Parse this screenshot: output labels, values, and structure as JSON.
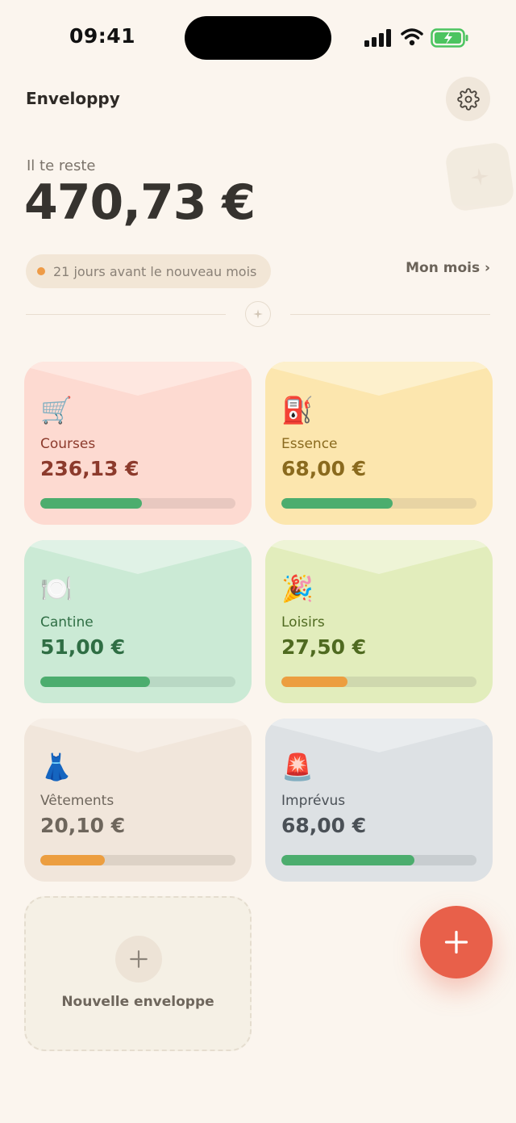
{
  "status_bar": {
    "time": "09:41"
  },
  "header": {
    "title": "Enveloppy"
  },
  "balance": {
    "label": "Il te reste",
    "amount": "470,73 €",
    "days_left": "21 jours avant le nouveau mois",
    "month_link": "Mon mois ›"
  },
  "envelopes": [
    {
      "emoji": "🛒",
      "name": "Courses",
      "amount": "236,13 €",
      "progress": 0.52,
      "colors": {
        "bg": "#FDDAD1",
        "flap": "#FEE7E0",
        "text": "#8C3A2C",
        "track": "#E8C8C0",
        "fill": "#4CAD6E"
      }
    },
    {
      "emoji": "⛽",
      "name": "Essence",
      "amount": "68,00 €",
      "progress": 0.57,
      "colors": {
        "bg": "#FCE6AE",
        "flap": "#FDF0CC",
        "text": "#8A6A1E",
        "track": "#E8D4A4",
        "fill": "#4CAD6E"
      }
    },
    {
      "emoji": "🍽️",
      "name": "Cantine",
      "amount": "51,00 €",
      "progress": 0.56,
      "colors": {
        "bg": "#CBEAD5",
        "flap": "#E0F2E6",
        "text": "#2F6E44",
        "track": "#B9D8C4",
        "fill": "#4CAD6E"
      }
    },
    {
      "emoji": "🎉",
      "name": "Loisirs",
      "amount": "27,50 €",
      "progress": 0.34,
      "colors": {
        "bg": "#E2EDBC",
        "flap": "#EEF4D6",
        "text": "#4F6A20",
        "track": "#CFD8AE",
        "fill": "#EC9E40"
      }
    },
    {
      "emoji": "👗",
      "name": "Vêtements",
      "amount": "20,10 €",
      "progress": 0.33,
      "colors": {
        "bg": "#F1E6DB",
        "flap": "#F6EEE6",
        "text": "#6E665C",
        "track": "#DDD2C6",
        "fill": "#EC9E40"
      }
    },
    {
      "emoji": "🚨",
      "name": "Imprévus",
      "amount": "68,00 €",
      "progress": 0.68,
      "colors": {
        "bg": "#DDE1E4",
        "flap": "#E9ECEE",
        "text": "#4A5056",
        "track": "#C8CDD0",
        "fill": "#4CAD6E"
      }
    }
  ],
  "new_envelope": {
    "label": "Nouvelle enveloppe"
  },
  "fab": {
    "icon": "plus-icon"
  }
}
